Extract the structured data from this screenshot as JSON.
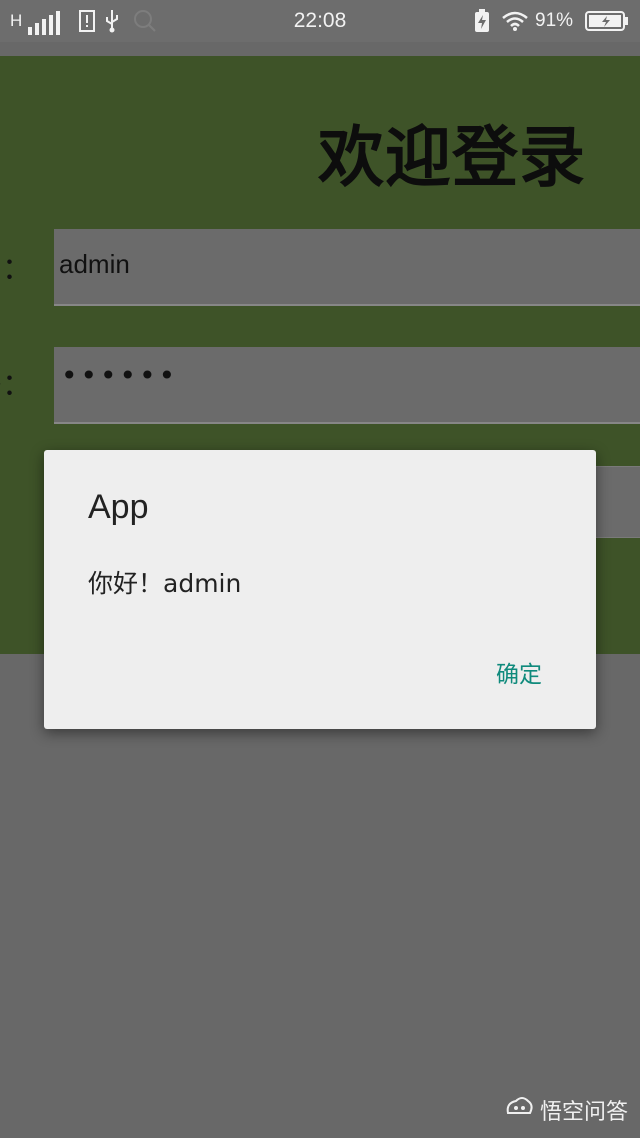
{
  "status_bar": {
    "network_type": "H",
    "time": "22:08",
    "battery_percent": "91%",
    "icons": [
      "signal-icon",
      "sim-icon",
      "usb-icon",
      "search-icon",
      "charging-icon",
      "wifi-icon",
      "battery-icon"
    ]
  },
  "login": {
    "title": "欢迎登录",
    "username_label": "号：",
    "username_value": "admin",
    "password_label": "码：",
    "password_value": "••••••"
  },
  "dialog": {
    "title": "App",
    "message": "你好！admin",
    "ok_label": "确定"
  },
  "watermark": {
    "text": "悟空问答"
  },
  "colors": {
    "login_background": "#3e5328",
    "dialog_background": "#eeeeee",
    "accent": "#0f8a7c",
    "overlay": "#686868"
  }
}
